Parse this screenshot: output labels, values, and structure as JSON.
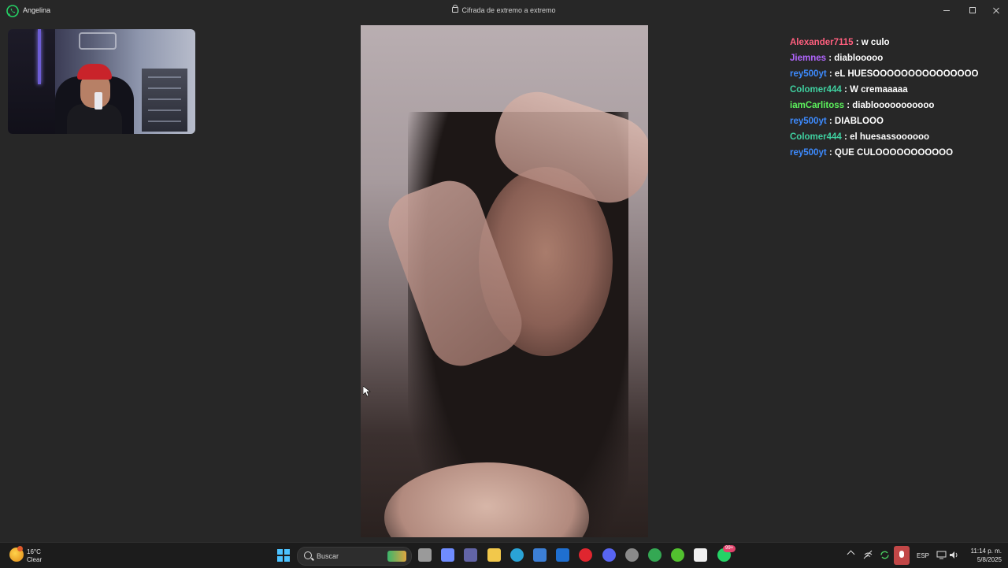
{
  "window": {
    "contact_name": "Angelina",
    "encryption_label": "Cifrada de extremo a extremo",
    "accent": "#25d366"
  },
  "chat": {
    "messages": [
      {
        "user": "Alexander7115",
        "text": "w culo",
        "color": "#ff5f7e"
      },
      {
        "user": "Jiemnes",
        "text": "diablooooo",
        "color": "#b266ff"
      },
      {
        "user": "rey500yt",
        "text": "eL HUESOOOOOOOOOOOOOOO",
        "color": "#3d8bff"
      },
      {
        "user": "Colomer444",
        "text": "W cremaaaaa",
        "color": "#3fd0a0"
      },
      {
        "user": "iamCarlitoss",
        "text": "diablooooooooooo",
        "color": "#5cf25c"
      },
      {
        "user": "rey500yt",
        "text": "DIABLOOO",
        "color": "#3d8bff"
      },
      {
        "user": "Colomer444",
        "text": "el huesassoooooo",
        "color": "#3fd0a0"
      },
      {
        "user": "rey500yt",
        "text": "QUE CULOOOOOOOOOOO",
        "color": "#3d8bff"
      }
    ]
  },
  "taskbar": {
    "weather_temp": "16°C",
    "weather_condition": "Clear",
    "search_placeholder": "Buscar",
    "whatsapp_badge": "99+",
    "language": "ESP",
    "time": "11:14 p. m.",
    "date": "5/8/2025",
    "apps": [
      {
        "name": "file-explorer-gray",
        "color": "#9a9a9a"
      },
      {
        "name": "copilot",
        "color": "#6f8cff"
      },
      {
        "name": "teams",
        "color": "#6264a7"
      },
      {
        "name": "file-explorer",
        "color": "#f2c84b"
      },
      {
        "name": "edge",
        "color": "#2aa3d6"
      },
      {
        "name": "store",
        "color": "#3c7fd6"
      },
      {
        "name": "dev-app",
        "color": "#1f6fd0"
      },
      {
        "name": "opera",
        "color": "#e0262f"
      },
      {
        "name": "discord",
        "color": "#5865f2"
      },
      {
        "name": "settings",
        "color": "#8a8a8a"
      },
      {
        "name": "chrome",
        "color": "#34a853"
      },
      {
        "name": "xbox",
        "color": "#52c12f"
      },
      {
        "name": "app-dark",
        "color": "#f0f0f0"
      },
      {
        "name": "whatsapp",
        "color": "#25d366"
      }
    ]
  }
}
